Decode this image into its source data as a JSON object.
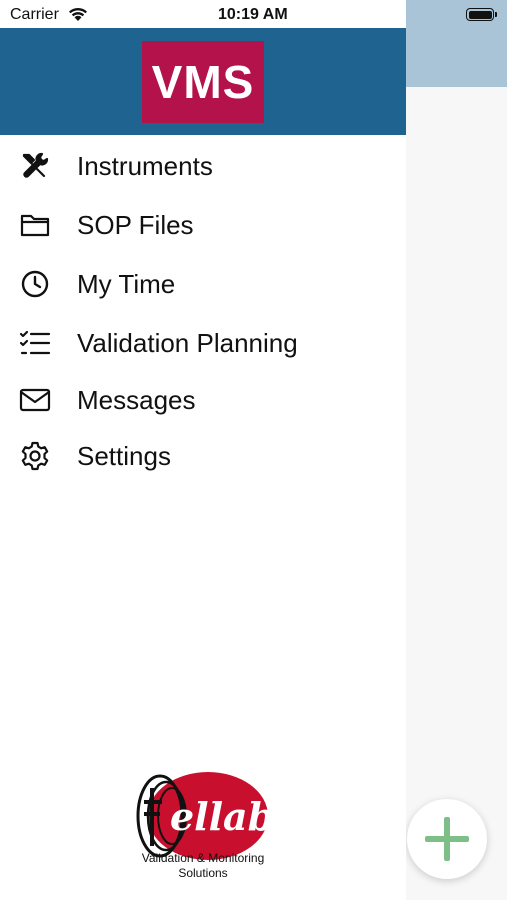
{
  "status_bar": {
    "carrier": "Carrier",
    "time": "10:19 AM"
  },
  "header": {
    "logo_text": "VMS",
    "logo_color": "#b3134a",
    "background_color": "#1f6391"
  },
  "menu": {
    "items": [
      {
        "label": "Instruments",
        "icon": "wrench-screwdriver-icon"
      },
      {
        "label": "SOP Files",
        "icon": "folder-icon"
      },
      {
        "label": "My Time",
        "icon": "clock-icon"
      },
      {
        "label": "Validation Planning",
        "icon": "checklist-icon"
      },
      {
        "label": "Messages",
        "icon": "envelope-icon"
      },
      {
        "label": "Settings",
        "icon": "gear-icon"
      }
    ]
  },
  "footer": {
    "brand": "ellab",
    "tagline_line1": "Validation & Monitoring",
    "tagline_line2": "Solutions"
  },
  "fab": {
    "icon": "plus-icon",
    "color": "#7dbf86"
  }
}
